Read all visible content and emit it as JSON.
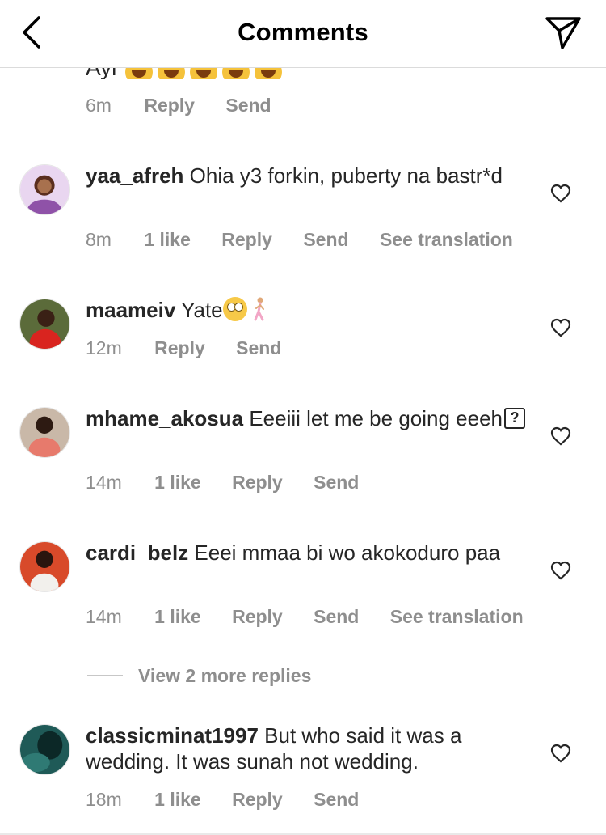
{
  "header": {
    "title": "Comments"
  },
  "partial_comment": {
    "text": "Ayi",
    "time": "6m",
    "reply_label": "Reply",
    "send_label": "Send"
  },
  "comments": [
    {
      "username": "yaa_afreh",
      "text": "Ohia y3 forkin, puberty na bastr*d",
      "time": "8m",
      "likes": "1 like",
      "reply_label": "Reply",
      "send_label": "Send",
      "translate_label": "See translation"
    },
    {
      "username": "maameiv",
      "text": "Yate",
      "time": "12m",
      "reply_label": "Reply",
      "send_label": "Send"
    },
    {
      "username": "mhame_akosua",
      "text": "Eeeiii let me be going eeeh",
      "unknown_glyph": "?",
      "time": "14m",
      "likes": "1 like",
      "reply_label": "Reply",
      "send_label": "Send"
    },
    {
      "username": "cardi_belz",
      "text": "Eeei mmaa bi wo akokoduro paa",
      "time": "14m",
      "likes": "1 like",
      "reply_label": "Reply",
      "send_label": "Send",
      "translate_label": "See translation"
    },
    {
      "username": "classicminat1997",
      "text": "But who said it was a wedding. It was sunah not wedding.",
      "time": "18m",
      "likes": "1 like",
      "reply_label": "Reply",
      "send_label": "Send"
    }
  ],
  "view_more_replies": "View 2 more replies",
  "icons": {
    "back": "chevron-left-icon",
    "direct": "paper-plane-icon",
    "like": "heart-outline-icon"
  },
  "colors": {
    "primary_text": "#262626",
    "secondary_text": "#8e8e8e",
    "divider": "#dbdbdb"
  }
}
